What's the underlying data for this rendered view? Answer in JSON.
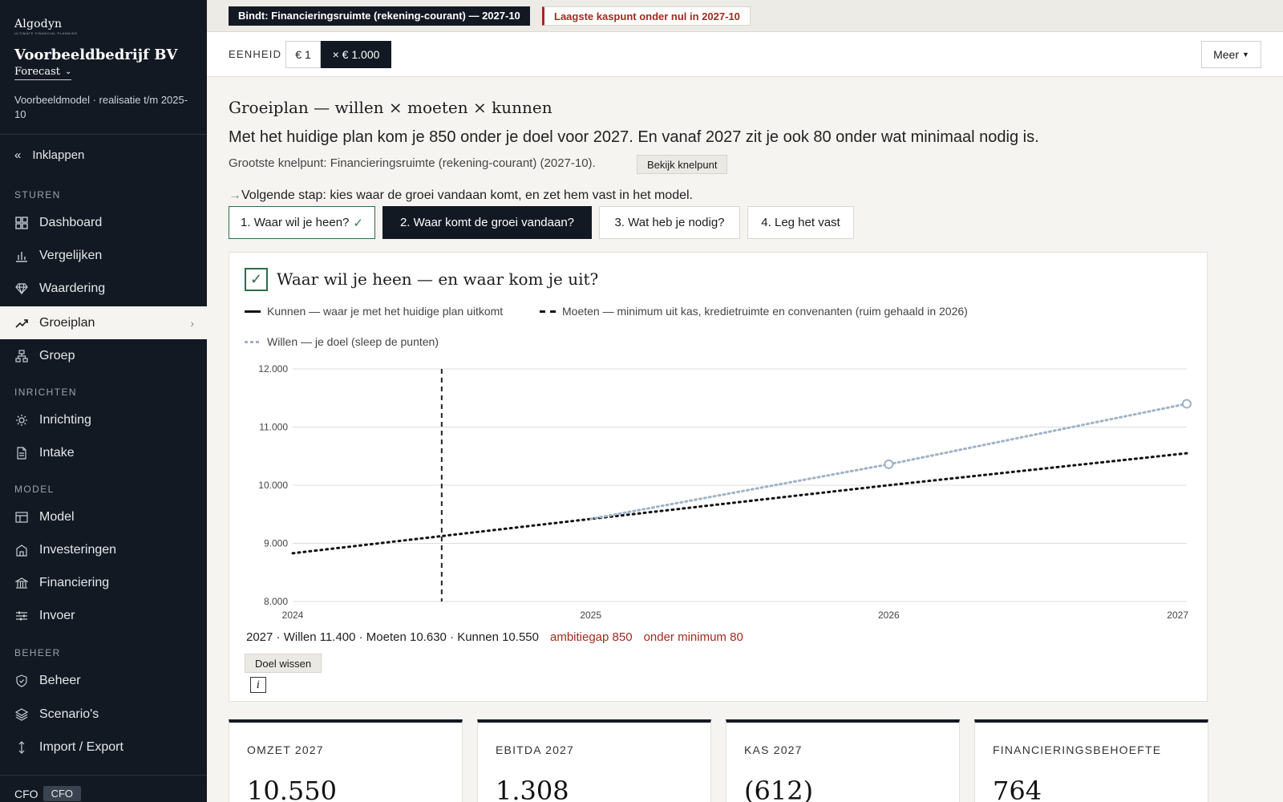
{
  "brand": {
    "logo": "Algodyn",
    "tagline": "ULTIMATE FINANCIAL PLANNING"
  },
  "company": "Voorbeeldbedrijf BV",
  "mode": "Forecast",
  "subinfo": "Voorbeeldmodel · realisatie t/m 2025-10",
  "collapse_label": "Inklappen",
  "nav": {
    "sturen_label": "STUREN",
    "dashboard": "Dashboard",
    "vergelijken": "Vergelijken",
    "waardering": "Waardering",
    "groeiplan": "Groeiplan",
    "groep": "Groep",
    "inrichten_label": "INRICHTEN",
    "inrichting": "Inrichting",
    "intake": "Intake",
    "model_label": "MODEL",
    "model": "Model",
    "investeringen": "Investeringen",
    "financiering": "Financiering",
    "invoer": "Invoer",
    "beheer_label": "BEHEER",
    "beheer": "Beheer",
    "scenarios": "Scenario's",
    "importexport": "Import / Export"
  },
  "role": {
    "label": "CFO",
    "badge": "CFO"
  },
  "status": {
    "binding": "Bindt: Financieringsruimte (rekening-courant) — 2027-10",
    "warning": "Laagste kaspunt onder nul in 2027-10"
  },
  "unit": {
    "label": "EENHEID",
    "opt1": "€ 1",
    "opt2": "× € 1.000",
    "selected": "× € 1.000"
  },
  "more": "Meer",
  "page_title": "Groeiplan — willen × moeten × kunnen",
  "headline": "Met het huidige plan kom je 850 onder je doel voor 2027. En vanaf 2027 zit je ook 80 onder wat minimaal nodig is.",
  "knelpunt": "Grootste knelpunt: Financieringsruimte (rekening-courant) (2027-10).",
  "knelpunt_button": "Bekijk knelpunt",
  "next_step": "Volgende stap: kies waar de groei vandaan komt, en zet hem vast in het model.",
  "steps": [
    "1. Waar wil je heen?",
    "2. Waar komt de groei vandaan?",
    "3. Wat heb je nodig?",
    "4. Leg het vast"
  ],
  "card_title": "Waar wil je heen — en waar kom je uit?",
  "legend": {
    "kunnen": "Kunnen — waar je met het huidige plan uitkomt",
    "moeten": "Moeten — minimum uit kas, kredietruimte en convenanten (ruim gehaald in 2026)",
    "willen": "Willen — je doel (sleep de punten)"
  },
  "colors": {
    "kunnen": "#111111",
    "moeten": "#111111",
    "willen": "#9fb2c8",
    "warn": "#a42a1c",
    "dark": "#121923"
  },
  "chart_data": {
    "type": "line",
    "x_ticks": [
      "2024",
      "2025",
      "2026",
      "2027"
    ],
    "y_ticks": [
      "12.000",
      "11.000",
      "10.000",
      "9.000",
      "8.000"
    ],
    "ylim": [
      8000,
      12000
    ],
    "xlim": [
      2024,
      2027
    ],
    "marker_x": 2024.5,
    "series": [
      {
        "name": "Moeten",
        "style": "dotted-dark",
        "points": [
          [
            2024,
            8830
          ],
          [
            2025,
            9420
          ],
          [
            2026,
            10000
          ],
          [
            2027,
            10550
          ]
        ]
      },
      {
        "name": "Willen",
        "style": "dotted-light",
        "points": [
          [
            2025,
            9420
          ],
          [
            2026,
            10360
          ],
          [
            2027,
            11400
          ]
        ],
        "handles": [
          [
            2026,
            10360
          ],
          [
            2027,
            11400
          ]
        ]
      }
    ]
  },
  "summary": {
    "values": "2027 · Willen 11.400 · Moeten 10.630 · Kunnen 10.550",
    "gap": "ambitiegap 850",
    "under": "onder minimum 80"
  },
  "clear_button": "Doel wissen",
  "info_icon": "i",
  "kpis": [
    {
      "label": "OMZET 2027",
      "value": "10.550"
    },
    {
      "label": "EBITDA 2027",
      "value": "1.308"
    },
    {
      "label": "KAS 2027",
      "value": "(612)"
    },
    {
      "label": "FINANCIERINGSBEHOEFTE",
      "value": "764"
    }
  ]
}
